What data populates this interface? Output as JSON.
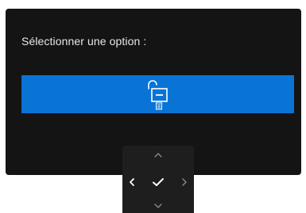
{
  "osd": {
    "prompt": "Sélectionner une option :",
    "option": {
      "icon": "unlock-icon",
      "selected": true
    }
  },
  "nav": {
    "up_icon": "chevron-up-icon",
    "left_icon": "chevron-left-icon",
    "ok_icon": "checkmark-icon",
    "right_icon": "chevron-right-icon",
    "down_icon": "chevron-down-icon"
  },
  "colors": {
    "panel": "#141414",
    "text": "#e8e8e8",
    "highlight": "#0a74d6",
    "nav_bg": "#1e1e1e",
    "nav_active": "#ffffff",
    "nav_inactive": "#8a8a8a"
  }
}
